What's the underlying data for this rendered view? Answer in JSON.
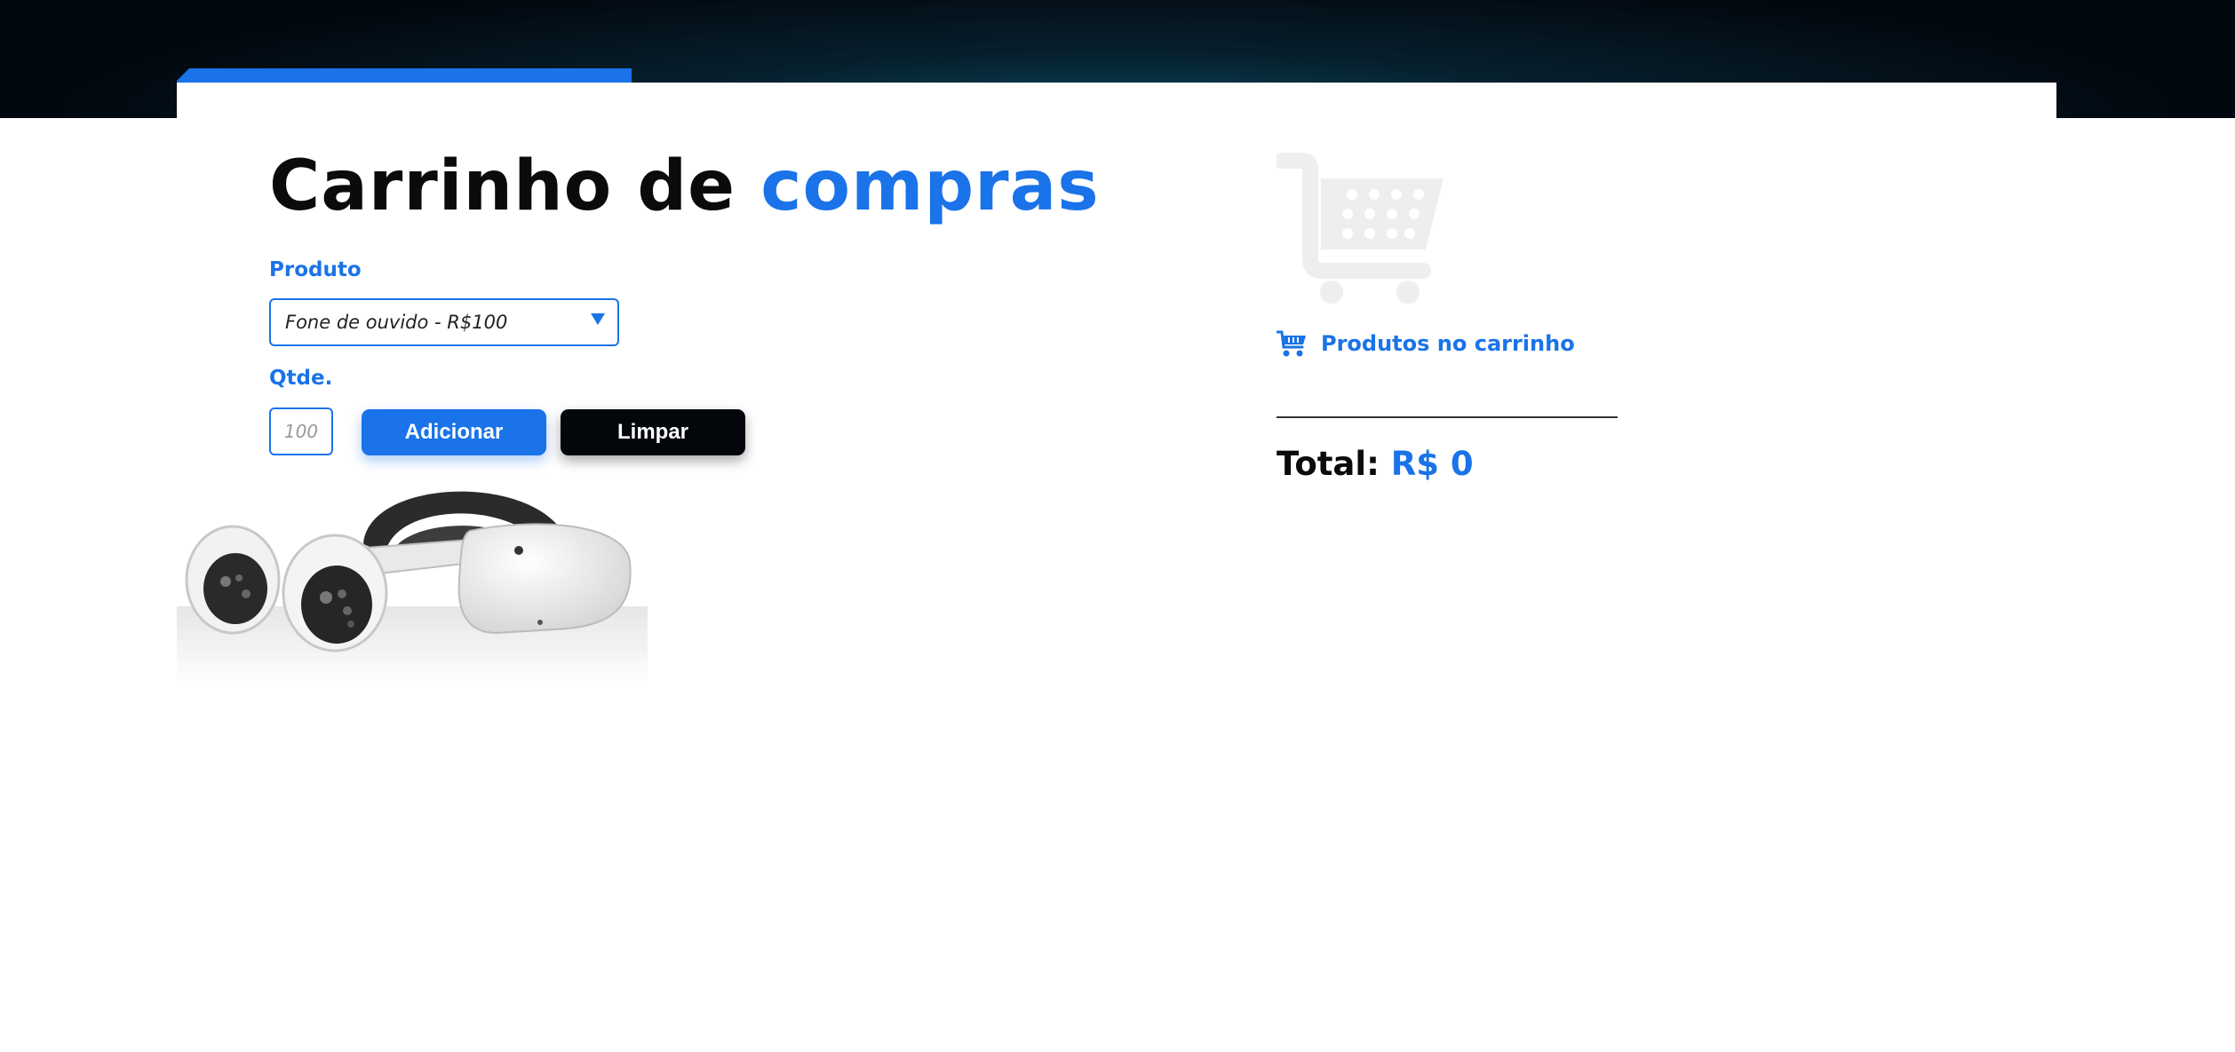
{
  "page": {
    "title_part1": "Carrinho de",
    "title_part2": "compras"
  },
  "form": {
    "product_label": "Produto",
    "product_selected": "Fone de ouvido - R$100",
    "qty_label": "Qtde.",
    "qty_placeholder": "100",
    "add_button": "Adicionar",
    "clear_button": "Limpar"
  },
  "cart": {
    "heading": "Produtos no carrinho",
    "total_label": "Total:",
    "total_value": "R$ 0"
  },
  "colors": {
    "accent": "#1a73e8",
    "dark": "#03070c",
    "cart_icon_placeholder": "#eeeeee"
  },
  "icons": {
    "big_cart": "shopping-cart-icon",
    "small_cart": "cart-icon",
    "select_arrow": "caret-down-icon",
    "product_image": "vr-headset-image"
  }
}
